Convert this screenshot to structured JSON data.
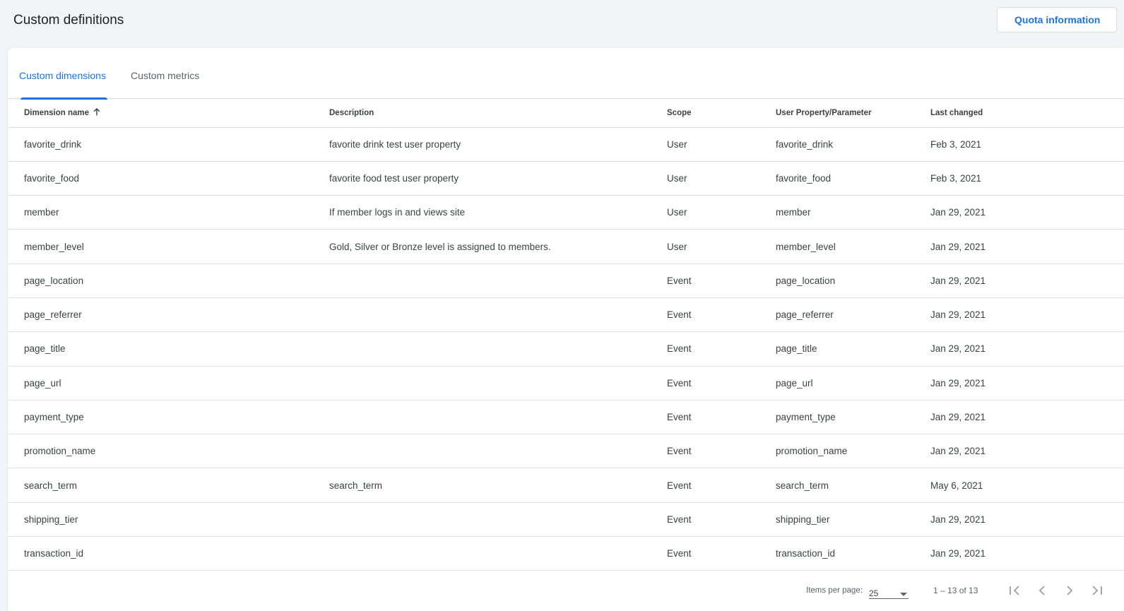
{
  "header": {
    "title": "Custom definitions",
    "quota_label": "Quota information"
  },
  "tabs": [
    {
      "label": "Custom dimensions",
      "active": true
    },
    {
      "label": "Custom metrics",
      "active": false
    }
  ],
  "table": {
    "columns": [
      "Dimension name",
      "Description",
      "Scope",
      "User Property/Parameter",
      "Last changed"
    ],
    "sort_column": "Dimension name",
    "sort_direction": "ascending",
    "rows": [
      {
        "name": "favorite_drink",
        "description": "favorite drink test user property",
        "scope": "User",
        "param": "favorite_drink",
        "changed": "Feb 3, 2021"
      },
      {
        "name": "favorite_food",
        "description": "favorite food test user property",
        "scope": "User",
        "param": "favorite_food",
        "changed": "Feb 3, 2021"
      },
      {
        "name": "member",
        "description": "If member logs in and views site",
        "scope": "User",
        "param": "member",
        "changed": "Jan 29, 2021"
      },
      {
        "name": "member_level",
        "description": "Gold, Silver or Bronze level is assigned to members.",
        "scope": "User",
        "param": "member_level",
        "changed": "Jan 29, 2021"
      },
      {
        "name": "page_location",
        "description": "",
        "scope": "Event",
        "param": "page_location",
        "changed": "Jan 29, 2021"
      },
      {
        "name": "page_referrer",
        "description": "",
        "scope": "Event",
        "param": "page_referrer",
        "changed": "Jan 29, 2021"
      },
      {
        "name": "page_title",
        "description": "",
        "scope": "Event",
        "param": "page_title",
        "changed": "Jan 29, 2021"
      },
      {
        "name": "page_url",
        "description": "",
        "scope": "Event",
        "param": "page_url",
        "changed": "Jan 29, 2021"
      },
      {
        "name": "payment_type",
        "description": "",
        "scope": "Event",
        "param": "payment_type",
        "changed": "Jan 29, 2021"
      },
      {
        "name": "promotion_name",
        "description": "",
        "scope": "Event",
        "param": "promotion_name",
        "changed": "Jan 29, 2021"
      },
      {
        "name": "search_term",
        "description": "search_term",
        "scope": "Event",
        "param": "search_term",
        "changed": "May 6, 2021"
      },
      {
        "name": "shipping_tier",
        "description": "",
        "scope": "Event",
        "param": "shipping_tier",
        "changed": "Jan 29, 2021"
      },
      {
        "name": "transaction_id",
        "description": "",
        "scope": "Event",
        "param": "transaction_id",
        "changed": "Jan 29, 2021"
      }
    ]
  },
  "pagination": {
    "items_per_page_label": "Items per page:",
    "items_per_page": "25",
    "range": "1 – 13 of 13"
  },
  "icons": {
    "sort": "arrow-upward-icon",
    "dropdown": "caret-down-icon",
    "first": "first-page-icon",
    "prev": "chevron-left-icon",
    "next": "chevron-right-icon",
    "last": "last-page-icon"
  },
  "colors": {
    "accent": "#1a73e8",
    "page_bg": "#f1f3f7",
    "text": "#3c4043",
    "border": "#e0e0e0"
  }
}
